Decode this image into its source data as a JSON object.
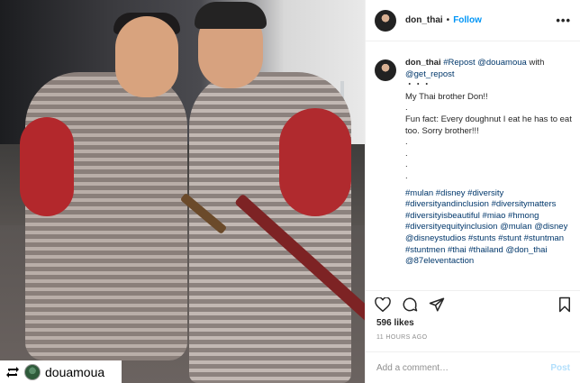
{
  "header": {
    "username": "don_thai",
    "separator": "•",
    "follow_label": "Follow",
    "more_label": "•••"
  },
  "caption": {
    "username": "don_thai",
    "lines_head": [
      {
        "text": "#Repost @douamoua",
        "kind": "link"
      },
      {
        "text": " with ",
        "kind": "plain"
      },
      {
        "text": "@get_repost",
        "kind": "link"
      }
    ],
    "body_lines": [
      "・・・",
      "My Thai brother Don!!",
      ".",
      "Fun fact: Every doughnut I eat he has to eat too. Sorry brother!!!",
      ".",
      ".",
      ".",
      "."
    ],
    "hashtags": "#mulan #disney #diversity #diversityandinclusion #diversitymatters #diversityisbeautiful #miao #hmong #diversityequityinclusion @mulan @disney @disneystudios #stunts #stunt #stuntman #stuntmen #thai #thailand @don_thai @87eleventaction"
  },
  "actions": {
    "like_icon": "heart-icon",
    "comment_icon": "comment-icon",
    "share_icon": "share-icon",
    "save_icon": "bookmark-icon"
  },
  "likes": "596 likes",
  "time": "11 HOURS AGO",
  "comment": {
    "placeholder": "Add a comment…",
    "post_label": "Post"
  },
  "repost_tag": {
    "icon": "repost-icon",
    "username": "douamoua"
  },
  "colors": {
    "link": "#00376b",
    "follow": "#0095f6",
    "post_disabled": "#b2dffc",
    "muted": "#8e8e8e"
  }
}
